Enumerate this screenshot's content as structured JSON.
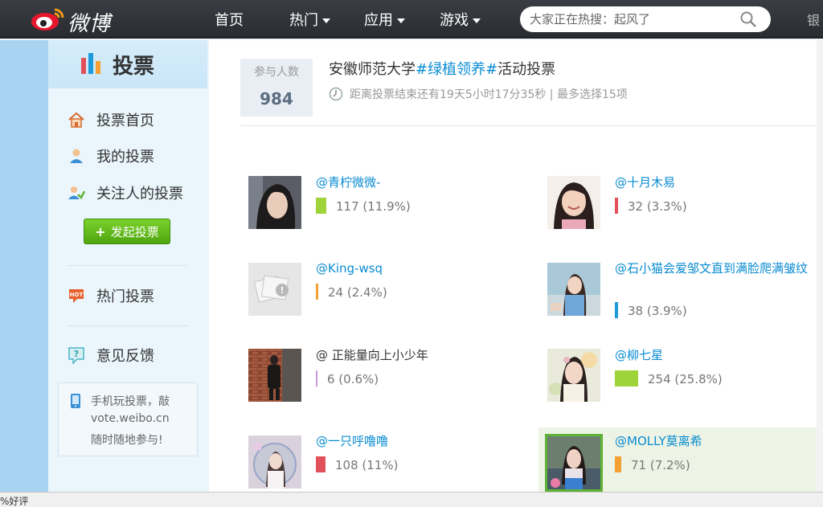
{
  "topbar": {
    "logo_text": "微博",
    "nav": [
      {
        "label": "首页",
        "dropdown": false
      },
      {
        "label": "热门",
        "dropdown": true
      },
      {
        "label": "应用",
        "dropdown": true
      },
      {
        "label": "游戏",
        "dropdown": true
      }
    ],
    "search_placeholder": "大家正在热搜：起风了",
    "right_glyph": "银"
  },
  "sidebar": {
    "title": "投票",
    "links": [
      {
        "label": "投票首页",
        "icon": "home-icon"
      },
      {
        "label": "我的投票",
        "icon": "user-icon"
      },
      {
        "label": "关注人的投票",
        "icon": "users-icon"
      }
    ],
    "create_label": "发起投票",
    "hot_label": "热门投票",
    "feedback_label": "意见反馈",
    "mobile": {
      "line1": "手机玩投票，敲",
      "line2": "vote.weibo.cn",
      "line3": "随时随地参与!"
    }
  },
  "vote": {
    "count_label": "参与人数",
    "count": "984",
    "title_prefix": "安徽师范大学",
    "title_tag": "#绿植领养#",
    "title_suffix": "活动投票",
    "meta": "距离投票结束还有19天5小时17分35秒 | 最多选择15项"
  },
  "candidates": [
    {
      "name": "@青柠微微-",
      "count": "117  (11.9%)",
      "percent": 11.9,
      "color": "#9fd33a",
      "plain": false,
      "selected": false
    },
    {
      "name": "@十月木易",
      "count": "32  (3.3%)",
      "percent": 3.3,
      "color": "#e2505a",
      "plain": false,
      "selected": false
    },
    {
      "name": "@King-wsq",
      "count": "24  (2.4%)",
      "percent": 2.4,
      "color": "#f5a033",
      "plain": false,
      "selected": false
    },
    {
      "name": "@石小猫会爱邹文直到满脸爬满皱纹",
      "count": "38  (3.9%)",
      "percent": 3.9,
      "color": "#1d9ad9",
      "plain": false,
      "selected": false
    },
    {
      "name": "@ 正能量向上小少年",
      "count": "6  (0.6%)",
      "percent": 0.6,
      "color": "#c79ad8",
      "plain": true,
      "selected": false
    },
    {
      "name": "@柳七星",
      "count": "254  (25.8%)",
      "percent": 25.8,
      "color": "#9fd33a",
      "plain": false,
      "selected": false
    },
    {
      "name": "@一只呼噜噜",
      "count": "108  (11%)",
      "percent": 11.0,
      "color": "#e2505a",
      "plain": false,
      "selected": false
    },
    {
      "name": "@MOLLY莫离希",
      "count": "71  (7.2%)",
      "percent": 7.2,
      "color": "#f5a033",
      "plain": false,
      "selected": true
    }
  ],
  "statusbar": {
    "text": "%好评"
  }
}
